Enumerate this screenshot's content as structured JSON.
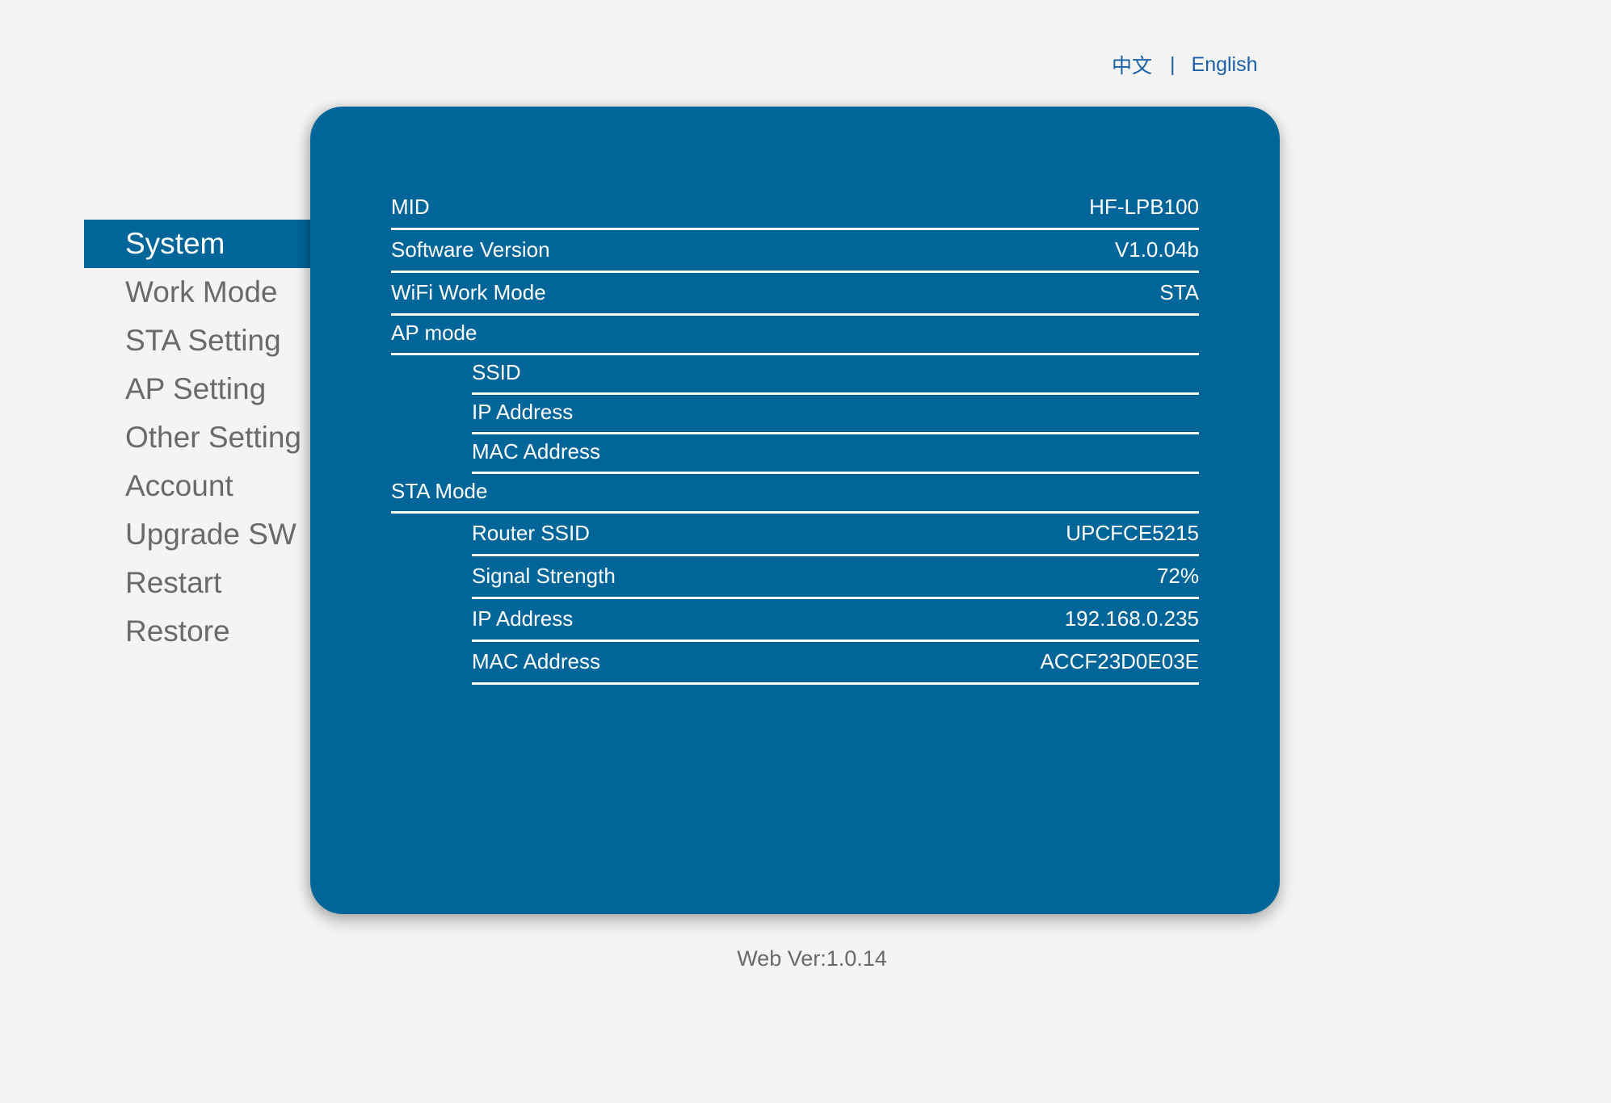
{
  "language": {
    "chinese_label": "中文",
    "separator": "|",
    "english_label": "English"
  },
  "sidebar": {
    "items": [
      {
        "label": "System",
        "active": true
      },
      {
        "label": "Work Mode",
        "active": false
      },
      {
        "label": "STA Setting",
        "active": false
      },
      {
        "label": "AP Setting",
        "active": false
      },
      {
        "label": "Other Setting",
        "active": false
      },
      {
        "label": "Account",
        "active": false
      },
      {
        "label": "Upgrade SW",
        "active": false
      },
      {
        "label": "Restart",
        "active": false
      },
      {
        "label": "Restore",
        "active": false
      }
    ]
  },
  "colors": {
    "accent": "#006699",
    "background": "#f4f4f4",
    "link": "#1a5fa8",
    "menu_text": "#6a6a6a"
  },
  "system_info": {
    "mid": {
      "label": "MID",
      "value": "HF-LPB100"
    },
    "software_version": {
      "label": "Software Version",
      "value": "V1.0.04b"
    },
    "wifi_work_mode": {
      "label": "WiFi Work Mode",
      "value": "STA"
    },
    "ap_mode": {
      "label": "AP mode",
      "ssid": {
        "label": "SSID",
        "value": ""
      },
      "ip_address": {
        "label": "IP Address",
        "value": ""
      },
      "mac_address": {
        "label": "MAC Address",
        "value": ""
      }
    },
    "sta_mode": {
      "label": "STA Mode",
      "router_ssid": {
        "label": "Router SSID",
        "value": "UPCFCE5215"
      },
      "signal_strength": {
        "label": "Signal Strength",
        "value": "72%"
      },
      "ip_address": {
        "label": "IP Address",
        "value": "192.168.0.235"
      },
      "mac_address": {
        "label": "MAC Address",
        "value": "ACCF23D0E03E"
      }
    }
  },
  "footer": {
    "web_version": "Web Ver:1.0.14"
  }
}
